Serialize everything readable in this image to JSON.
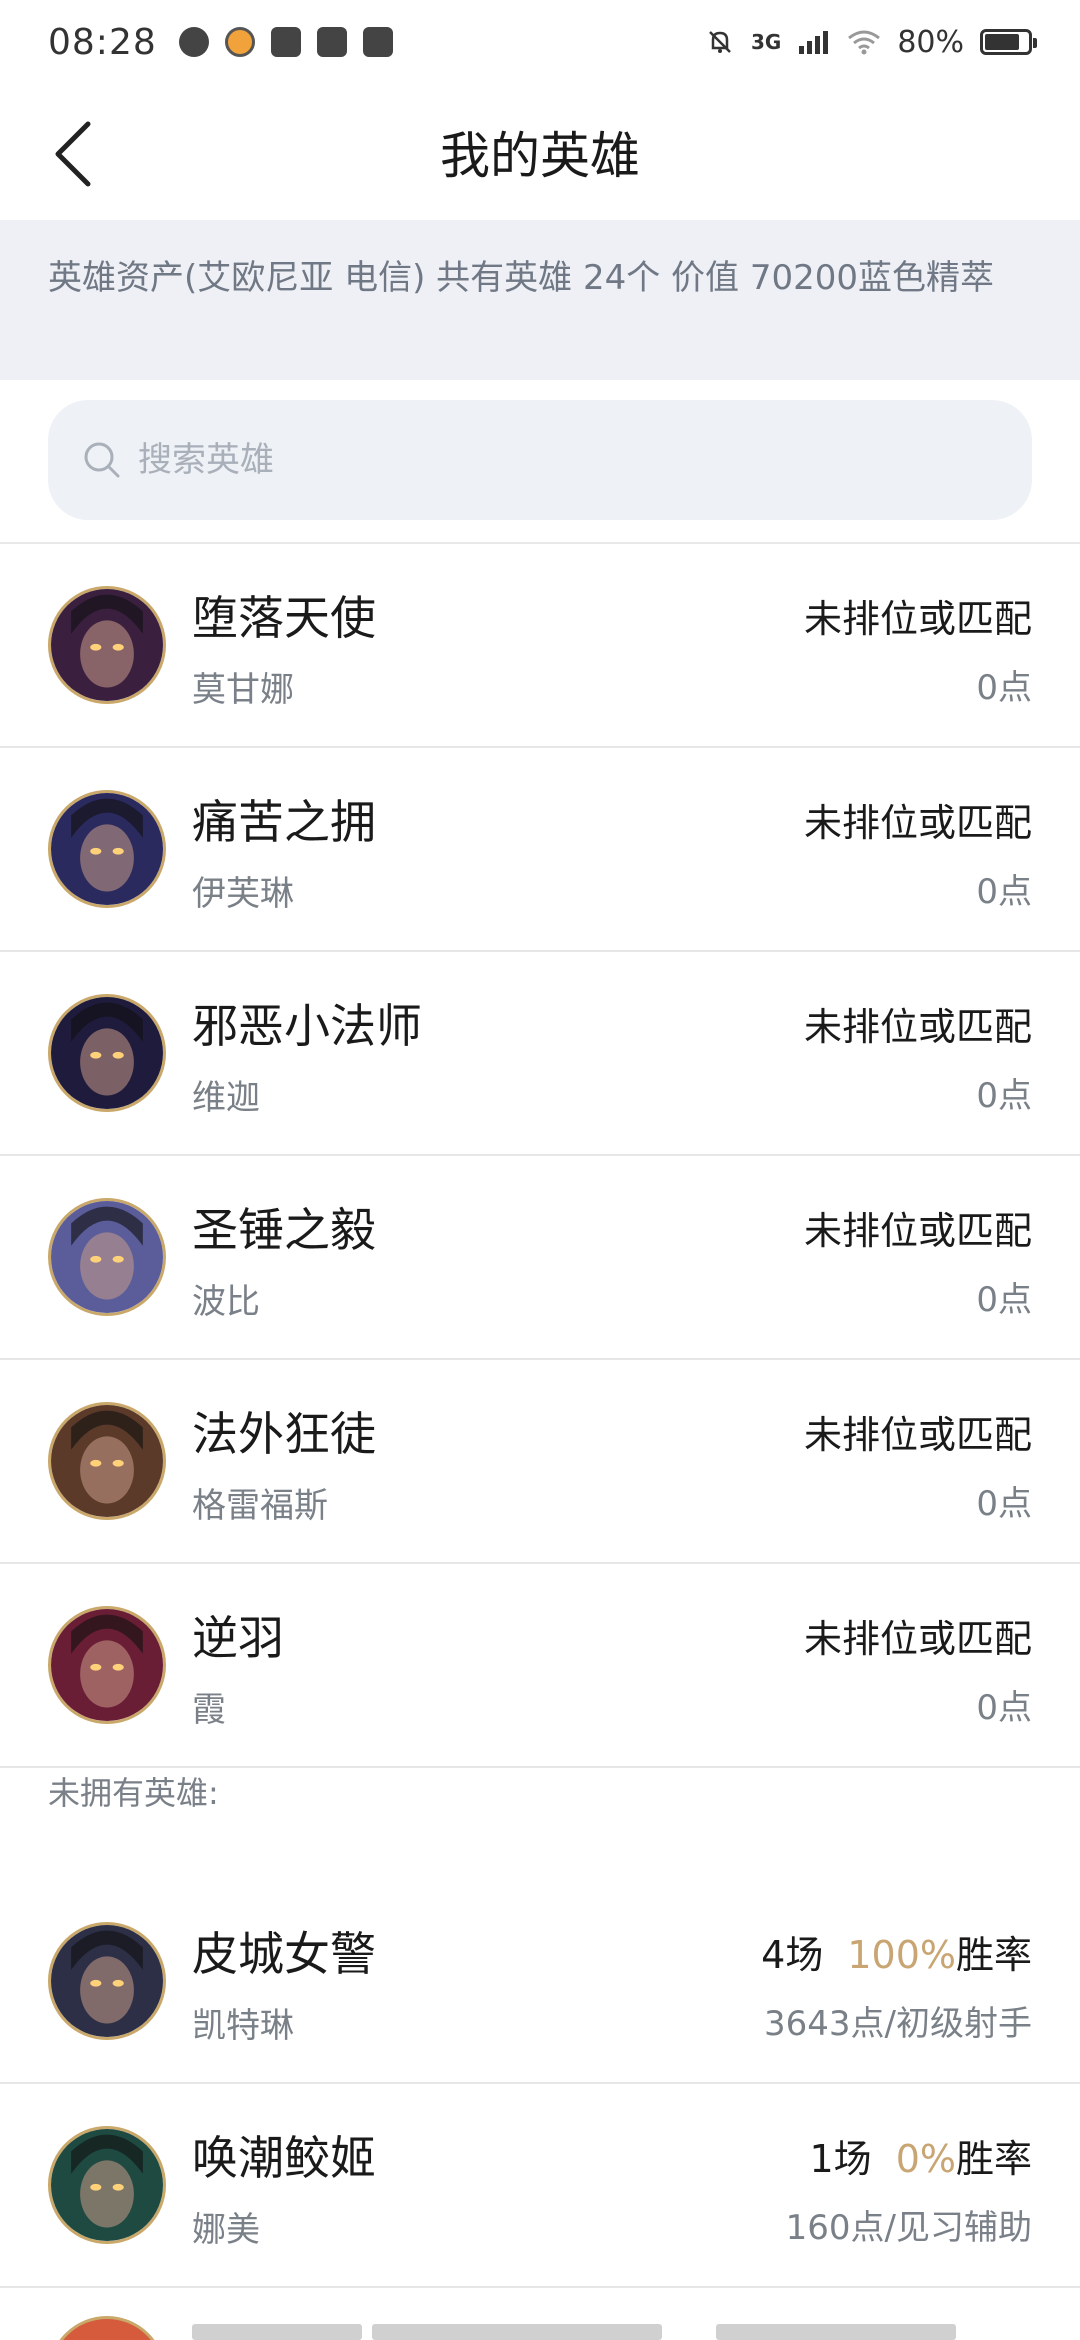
{
  "status": {
    "time": "08:28",
    "network": "3G",
    "battery": "80%",
    "battery_level": 0.8
  },
  "nav": {
    "title": "我的英雄",
    "back_icon": "chevron-left-icon"
  },
  "assets": {
    "text": "英雄资产(艾欧尼亚 电信)  共有英雄 24个  价值 70200蓝色精萃"
  },
  "search": {
    "placeholder": "搜索英雄",
    "value": ""
  },
  "owned": [
    {
      "title": "堕落天使",
      "name": "莫甘娜",
      "status": "未排位或匹配",
      "points": "0点",
      "color": "#3a1f3f"
    },
    {
      "title": "痛苦之拥",
      "name": "伊芙琳",
      "status": "未排位或匹配",
      "points": "0点",
      "color": "#2b2a5e"
    },
    {
      "title": "邪恶小法师",
      "name": "维迦",
      "status": "未排位或匹配",
      "points": "0点",
      "color": "#1e1b3c"
    },
    {
      "title": "圣锤之毅",
      "name": "波比",
      "status": "未排位或匹配",
      "points": "0点",
      "color": "#5a5d9a"
    },
    {
      "title": "法外狂徒",
      "name": "格雷福斯",
      "status": "未排位或匹配",
      "points": "0点",
      "color": "#5b3a2a"
    },
    {
      "title": "逆羽",
      "name": "霞",
      "status": "未排位或匹配",
      "points": "0点",
      "color": "#6a1e36"
    }
  ],
  "unowned_label": "未拥有英雄:",
  "unowned": [
    {
      "title": "皮城女警",
      "name": "凯特琳",
      "games": "4场",
      "rate": "100%",
      "rate_label": "胜率",
      "points_tier": "3643点/初级射手",
      "color": "#2c2f45"
    },
    {
      "title": "唤潮鲛姬",
      "name": "娜美",
      "games": "1场",
      "rate": "0%",
      "rate_label": "胜率",
      "points_tier": "160点/见习辅助",
      "color": "#1f4a42"
    }
  ],
  "colors": {
    "accent_gold": "#c8a573",
    "secondary_text": "#7a8088",
    "assets_bg": "#eef0f5"
  }
}
